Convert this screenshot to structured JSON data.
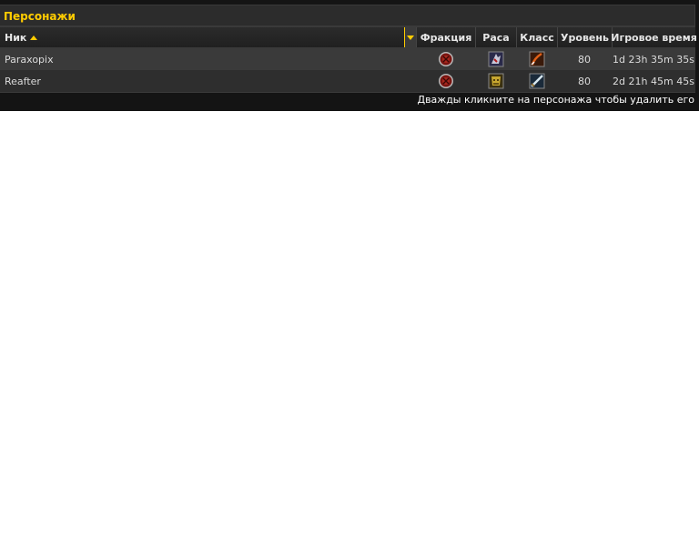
{
  "panel": {
    "title": "Персонажи",
    "footer_hint": "Дважды кликните на персонажа чтобы удалить его",
    "colors": {
      "accent": "#ffcc00",
      "title_bg": "#2c2c2c",
      "row_odd": "#3a3a3a",
      "row_even": "#2e2e2e",
      "panel_bg": "#141414"
    }
  },
  "table": {
    "columns": {
      "name": "Ник",
      "faction": "Фракция",
      "race": "Раса",
      "class": "Класс",
      "level": "Уровень",
      "time": "Игровое время"
    },
    "sort": {
      "column": "name",
      "direction": "asc"
    },
    "rows": [
      {
        "name": "Paraxopix",
        "faction_icon": "horde-faction-icon",
        "race_icon": "undead-race-icon",
        "class_icon": "rogue-class-icon",
        "level": "80",
        "time": "1d 23h 35m 35s"
      },
      {
        "name": "Reafter",
        "faction_icon": "horde-faction-icon",
        "race_icon": "orc-race-icon",
        "class_icon": "warrior-class-icon",
        "level": "80",
        "time": "2d 21h 45m 45s"
      }
    ]
  }
}
